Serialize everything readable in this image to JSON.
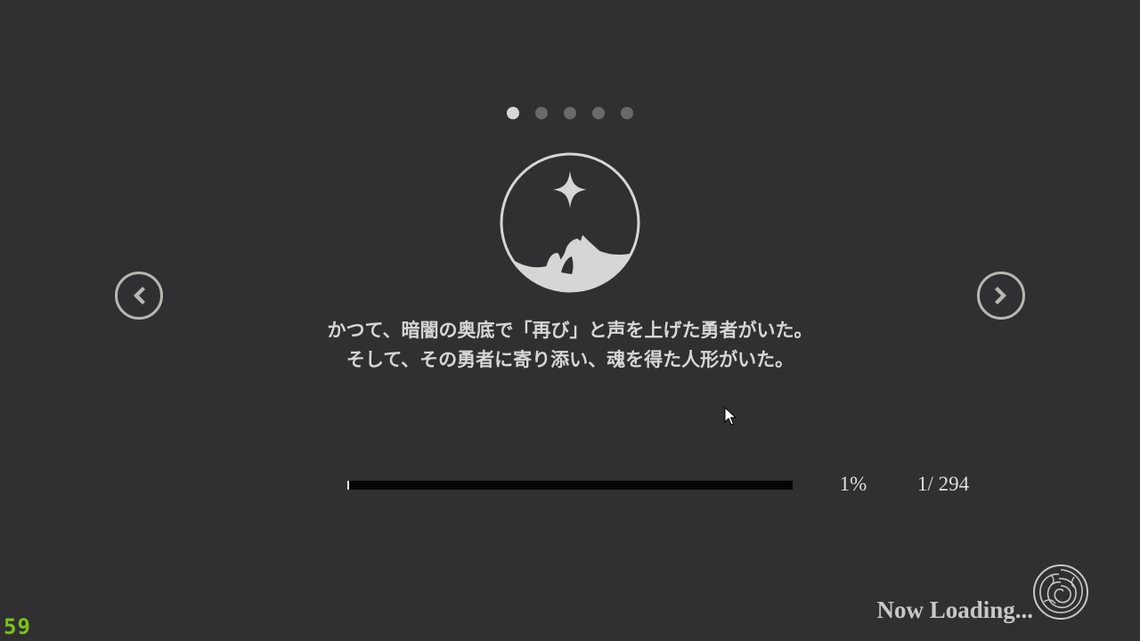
{
  "pager": {
    "total": 5,
    "active_index": 0
  },
  "navigation": {
    "prev_icon": "chevron-left-icon",
    "next_icon": "chevron-right-icon"
  },
  "emblem": {
    "icon": "star-night-emblem-icon"
  },
  "story": {
    "line1": "かつて、暗闇の奥底で「再び」と声を上げた勇者がいた。",
    "line2": "そして、その勇者に寄り添い、魂を得た人形がいた。"
  },
  "loading": {
    "progress_percent_value": 1,
    "progress_percent_label": "1%",
    "page_counter": "1/ 294",
    "status_text": "Now Loading...",
    "status_icon": "rose-icon"
  },
  "debug": {
    "fps": "59"
  },
  "colors": {
    "background": "#303032",
    "text": "#d6d6d6",
    "dot_active": "#d8d8d8",
    "dot_inactive": "#6a6a6c",
    "progress_track": "#050505",
    "progress_fill": "#f0f0f0",
    "fps": "#7ec21a"
  }
}
